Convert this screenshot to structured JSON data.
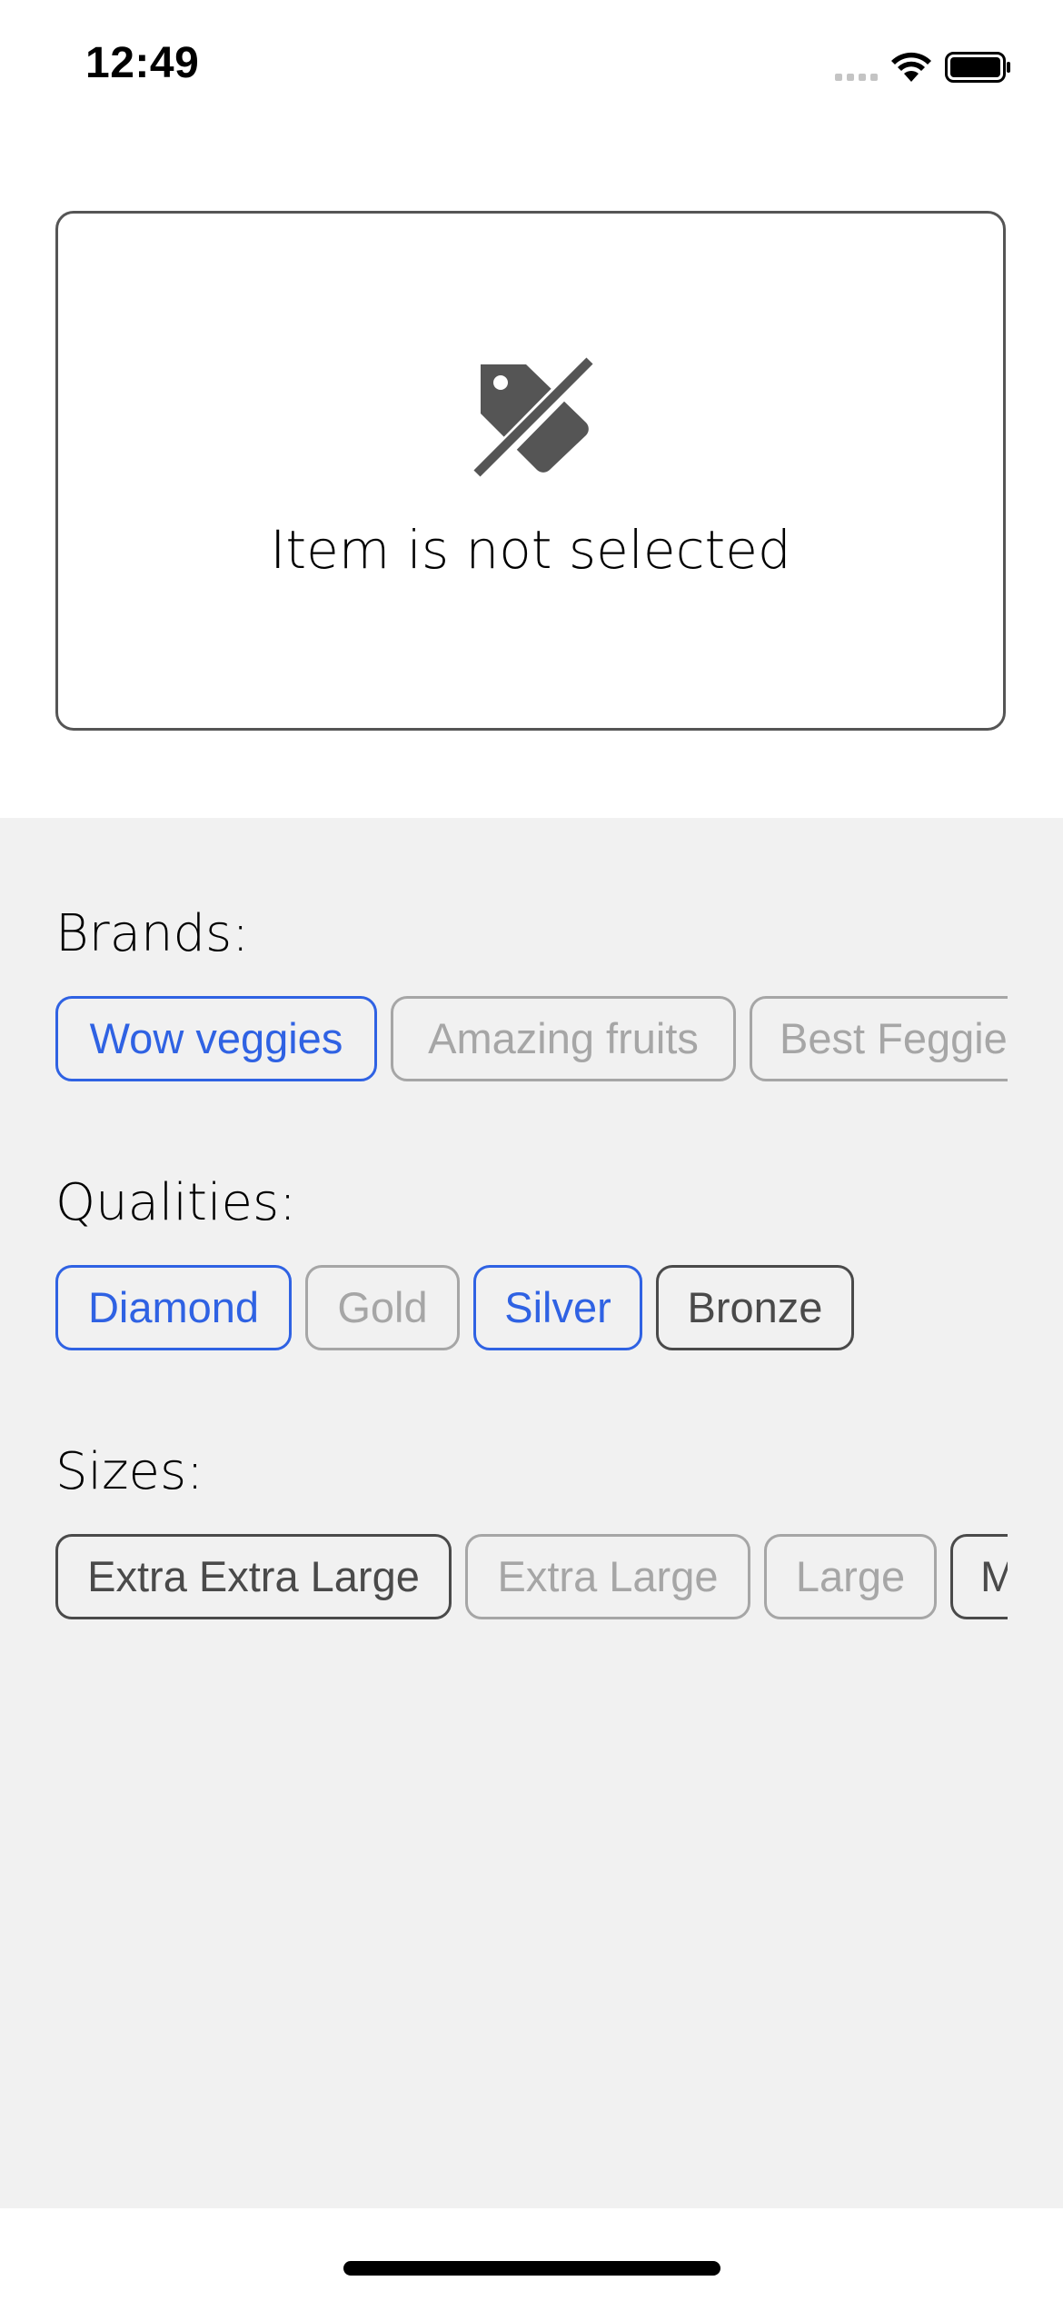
{
  "status_bar": {
    "time": "12:49"
  },
  "selection_card": {
    "icon": "tag-slash-icon",
    "message": "Item is not selected"
  },
  "filters": {
    "brands": {
      "title": "Brands:",
      "chips": [
        {
          "label": "Wow veggies",
          "state": "selected"
        },
        {
          "label": "Amazing fruits",
          "state": "disabled"
        },
        {
          "label": "Best Feggies",
          "state": "disabled"
        }
      ]
    },
    "qualities": {
      "title": "Qualities:",
      "chips": [
        {
          "label": "Diamond",
          "state": "selected"
        },
        {
          "label": "Gold",
          "state": "disabled"
        },
        {
          "label": "Silver",
          "state": "selected"
        },
        {
          "label": "Bronze",
          "state": "enabled"
        }
      ]
    },
    "sizes": {
      "title": "Sizes:",
      "chips": [
        {
          "label": "Extra Extra Large",
          "state": "enabled"
        },
        {
          "label": "Extra Large",
          "state": "disabled"
        },
        {
          "label": "Large",
          "state": "disabled"
        },
        {
          "label": "Medium",
          "state": "enabled"
        }
      ]
    }
  },
  "colors": {
    "selected": "#2f62e3",
    "enabled": "#4a4a4a",
    "disabled": "#a6a6a6",
    "panel_background": "#f1f1f1"
  }
}
